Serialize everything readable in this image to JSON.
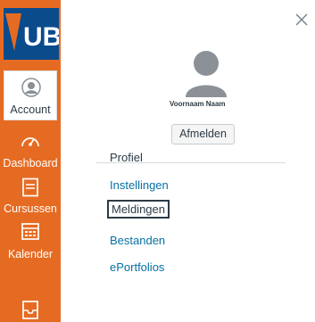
{
  "logo": {
    "text": "UB"
  },
  "nav": {
    "account": "Account",
    "dashboard": "Dashboard",
    "courses": "Cursussen",
    "calendar": "Kalender"
  },
  "profile": {
    "name": "Voornaam Naam",
    "logout": "Afmelden"
  },
  "links": [
    "Profiel",
    "Instellingen",
    "Meldingen",
    "Bestanden",
    "ePortfolios"
  ],
  "colors": {
    "sidebar": "#e66b22",
    "link": "#0770a3",
    "text": "#2d3b45"
  },
  "icons": {
    "close": "close-icon",
    "avatar": "avatar-icon"
  }
}
